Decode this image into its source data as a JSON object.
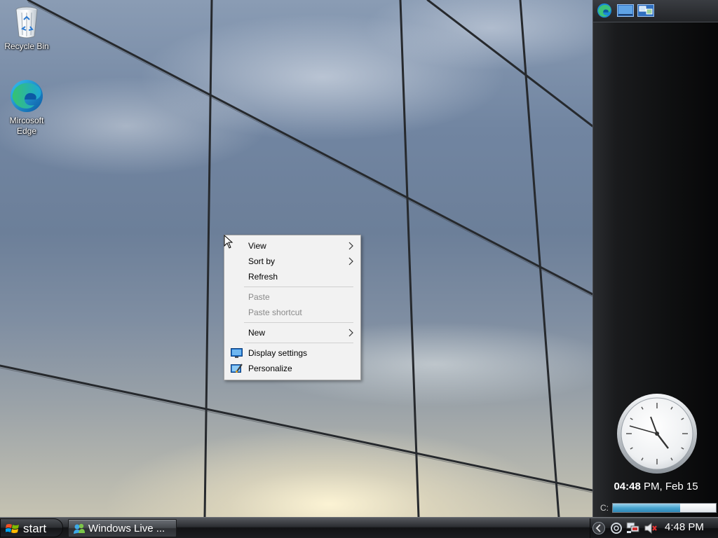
{
  "desktop": {
    "icons": [
      {
        "label": "Recycle Bin",
        "icon": "recycle-bin-icon"
      },
      {
        "label": "Mircosoft Edge",
        "icon": "edge-icon"
      }
    ]
  },
  "context_menu": {
    "items": [
      {
        "label": "View",
        "submenu": true,
        "enabled": true
      },
      {
        "label": "Sort by",
        "submenu": true,
        "enabled": true
      },
      {
        "label": "Refresh",
        "submenu": false,
        "enabled": true
      },
      {
        "label": "Paste",
        "submenu": false,
        "enabled": false
      },
      {
        "label": "Paste shortcut",
        "submenu": false,
        "enabled": false
      },
      {
        "label": "New",
        "submenu": true,
        "enabled": true
      },
      {
        "label": "Display settings",
        "icon": "display-icon",
        "enabled": true
      },
      {
        "label": "Personalize",
        "icon": "personalize-icon",
        "enabled": true
      }
    ]
  },
  "sidebar": {
    "toolbar_icons": [
      "edge-icon",
      "show-desktop-icon",
      "gadgets-icon"
    ],
    "clock": {
      "time_bold": "04:48",
      "date_rest": " PM, Feb 15"
    },
    "drive_meter": {
      "label": "C:",
      "used_fraction": 0.65
    }
  },
  "taskbar": {
    "start_label": "start",
    "tasks": [
      {
        "label": "Windows Live ...",
        "icon": "windows-live-messenger-icon"
      }
    ],
    "tray": {
      "icons": [
        "tray-expand-icon",
        "sync-icon",
        "network-icon",
        "volume-muted-icon"
      ],
      "time": "4:48 PM"
    }
  },
  "colors": {
    "menu_bg": "#f2f2f2",
    "disabled_text": "#8a8a8a",
    "drive_fill": "#4aa6d0",
    "taskbar": "#1c1d20"
  }
}
